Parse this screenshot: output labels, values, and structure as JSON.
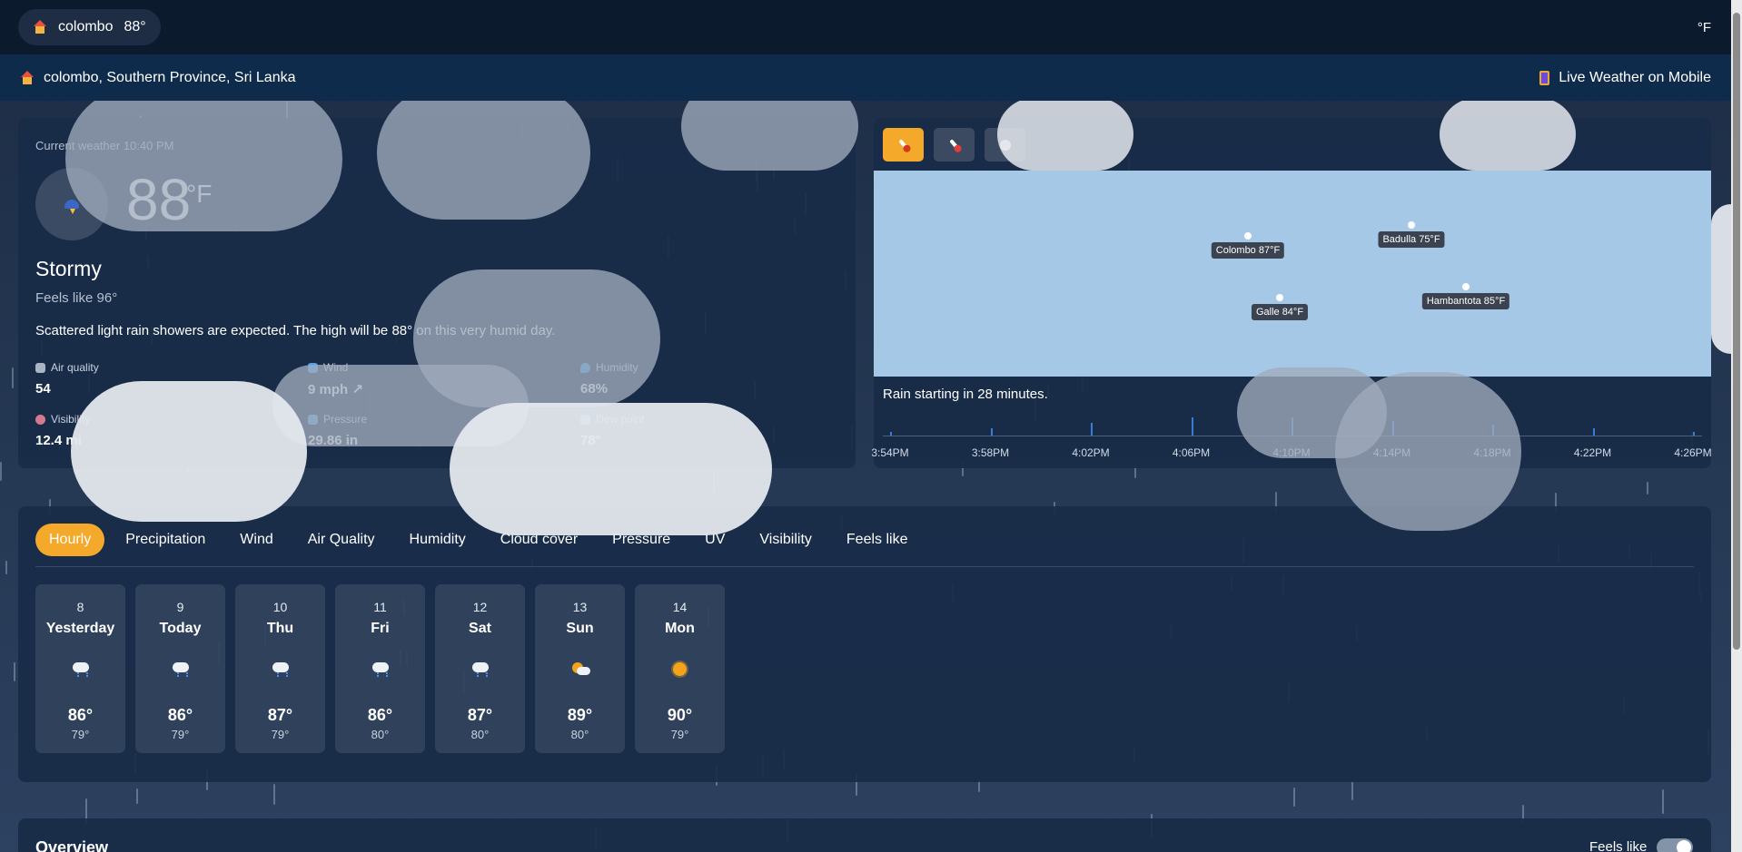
{
  "topbar": {
    "location_name": "colombo",
    "location_temp": "88°",
    "unit_toggle": "°F"
  },
  "subbar": {
    "full_location": "colombo, Southern Province, Sri Lanka",
    "mobile_link": "Live Weather on Mobile"
  },
  "current": {
    "time_label": "Current weather 10:40 PM",
    "icon": "storm-icon",
    "temp": "88",
    "unit": "°F",
    "condition": "Stormy",
    "feels_like": "Feels like 96°",
    "description": "Scattered light rain showers are expected. The high will be 88° on this very humid day.",
    "metrics": [
      {
        "label": "Air quality",
        "value": "54",
        "icon": "air-quality-icon"
      },
      {
        "label": "Wind",
        "value": "9 mph ↗",
        "icon": "wind-icon"
      },
      {
        "label": "Humidity",
        "value": "68%",
        "icon": "humidity-icon"
      },
      {
        "label": "Visibility",
        "value": "12.4 mi",
        "icon": "visibility-icon"
      },
      {
        "label": "Pressure",
        "value": "29.86 in",
        "icon": "pressure-icon"
      },
      {
        "label": "Dew point",
        "value": "78°",
        "icon": "dew-point-icon"
      }
    ]
  },
  "map": {
    "tools": [
      "temperature-layer",
      "temperature-alt-layer",
      "wind-layer"
    ],
    "pins": [
      {
        "label": "Colombo 87°F"
      },
      {
        "label": "Badulla 75°F"
      },
      {
        "label": "Galle 84°F"
      },
      {
        "label": "Hambantota 85°F"
      }
    ],
    "rain_message": "Rain starting in 28 minutes.",
    "timeline_labels": [
      "3:54PM",
      "3:58PM",
      "4:02PM",
      "4:06PM",
      "4:10PM",
      "4:14PM",
      "4:18PM",
      "4:22PM",
      "4:26PM"
    ]
  },
  "forecast": {
    "tabs": [
      "Hourly",
      "Precipitation",
      "Wind",
      "Air Quality",
      "Humidity",
      "Cloud cover",
      "Pressure",
      "UV",
      "Visibility",
      "Feels like"
    ],
    "active_tab": "Hourly",
    "days": [
      {
        "num": "8",
        "name": "Yesterday",
        "icon": "rain-cloud-icon",
        "hi": "86°",
        "lo": "79°"
      },
      {
        "num": "9",
        "name": "Today",
        "icon": "rain-cloud-icon",
        "hi": "86°",
        "lo": "79°"
      },
      {
        "num": "10",
        "name": "Thu",
        "icon": "rain-cloud-icon",
        "hi": "87°",
        "lo": "79°"
      },
      {
        "num": "11",
        "name": "Fri",
        "icon": "rain-cloud-icon",
        "hi": "86°",
        "lo": "80°"
      },
      {
        "num": "12",
        "name": "Sat",
        "icon": "rain-cloud-icon",
        "hi": "87°",
        "lo": "80°"
      },
      {
        "num": "13",
        "name": "Sun",
        "icon": "partly-sunny-icon",
        "hi": "89°",
        "lo": "80°"
      },
      {
        "num": "14",
        "name": "Mon",
        "icon": "sun-icon",
        "hi": "90°",
        "lo": "79°"
      }
    ]
  },
  "overview": {
    "title": "Overview",
    "toggle_label": "Feels like"
  },
  "colors": {
    "accent": "#f4a92a",
    "map_water": "#a5c8e7",
    "topbar": "#0c1a2e",
    "subbar": "#0f2b4b"
  }
}
